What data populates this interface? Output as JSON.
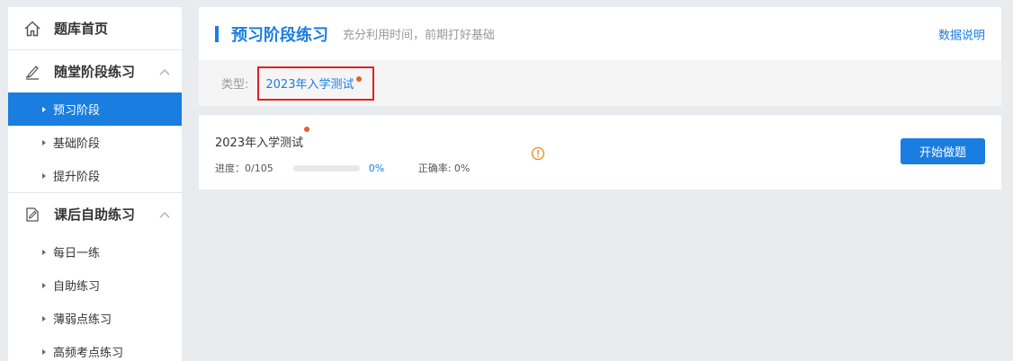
{
  "sidebar": {
    "home_label": "题库首页",
    "groups": [
      {
        "label": "随堂阶段练习",
        "items": [
          "预习阶段",
          "基础阶段",
          "提升阶段"
        ]
      },
      {
        "label": "课后自助练习",
        "items": [
          "每日一练",
          "自助练习",
          "薄弱点练习",
          "高频考点练习"
        ]
      }
    ],
    "active_item": "预习阶段"
  },
  "header": {
    "title": "预习阶段练习",
    "subtitle": "充分利用时间，前期打好基础",
    "data_link": "数据说明"
  },
  "filter": {
    "label": "类型:",
    "selected": "2023年入学测试"
  },
  "exercise": {
    "title": "2023年入学测试",
    "progress_label": "进度：0/105",
    "progress_fraction": 0,
    "progress_percent": "0%",
    "accuracy_label": "正确率: 0%",
    "start_button": "开始做题"
  },
  "colors": {
    "accent": "#1a7de0",
    "highlight_border": "#e02020",
    "notice_dot": "#f05a2a",
    "info_icon": "#f0851a"
  }
}
